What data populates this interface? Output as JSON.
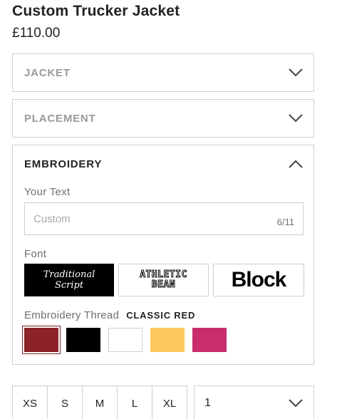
{
  "product": {
    "title": "Custom Trucker Jacket",
    "price": "£110.00"
  },
  "accordions": {
    "jacket": {
      "label": "JACKET",
      "expanded": false
    },
    "placement": {
      "label": "PLACEMENT",
      "expanded": false
    },
    "embroidery": {
      "label": "EMBROIDERY",
      "expanded": true
    }
  },
  "embroidery": {
    "text_label": "Your Text",
    "text_placeholder": "Custom",
    "char_counter": "6/11",
    "font_label": "Font",
    "fonts": [
      {
        "line1": "Traditional",
        "line2": "Script",
        "selected": true
      },
      {
        "line1": "ATHLETIC",
        "line2": "BEAN",
        "selected": false
      },
      {
        "line1": "Block",
        "line2": "",
        "selected": false
      }
    ],
    "thread_label": "Embroidery Thread",
    "thread_selected": "CLASSIC RED",
    "threads": [
      {
        "color": "#8b2328",
        "selected": true
      },
      {
        "color": "#000000",
        "selected": false
      },
      {
        "color": "#ffffff",
        "selected": false
      },
      {
        "color": "#fcc95c",
        "selected": false
      },
      {
        "color": "#c72e6b",
        "selected": false
      }
    ]
  },
  "sizes": [
    "XS",
    "S",
    "M",
    "L",
    "XL"
  ],
  "quantity": {
    "value": "1"
  },
  "colors": {
    "border": "#cfcfcf",
    "muted_text": "#9a9a9a",
    "text": "#222222"
  },
  "icons": {
    "collapsed": "chevron-down-icon",
    "expanded": "chevron-up-icon"
  }
}
